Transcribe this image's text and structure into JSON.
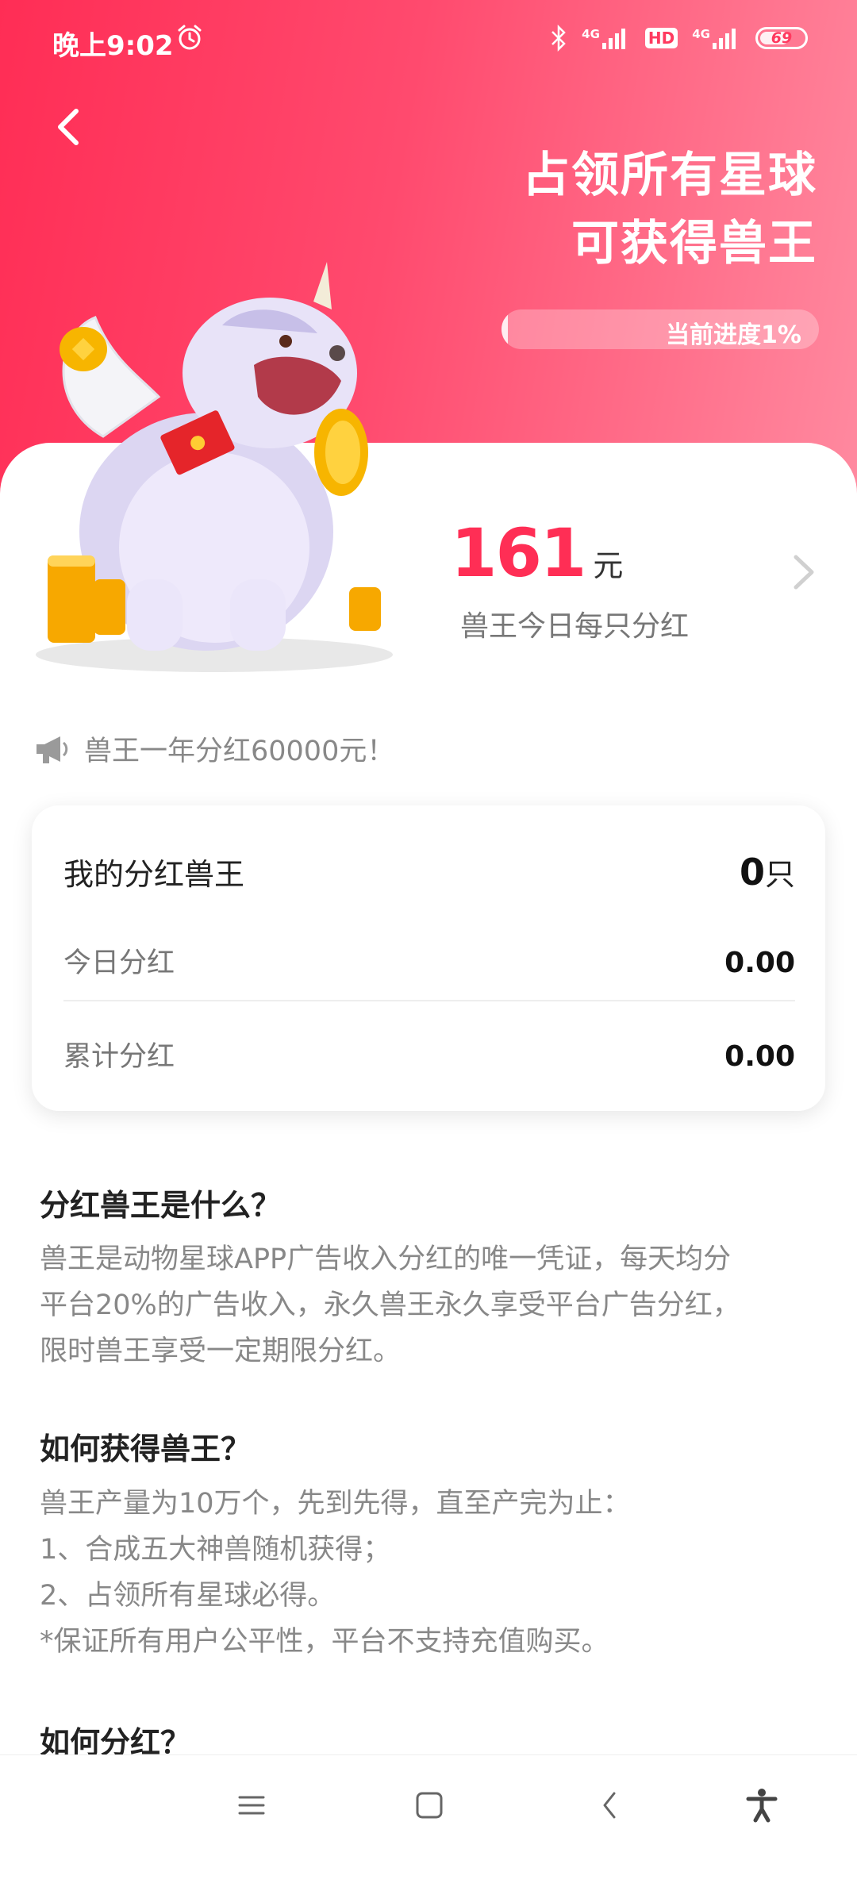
{
  "status_bar": {
    "time": "晚上9:02",
    "network_1": "4G",
    "hd_label": "HD",
    "network_2": "4G",
    "battery": "69"
  },
  "hero": {
    "title_line1": "占领所有星球",
    "title_line2": "可获得兽王",
    "progress_label": "当前进度1%",
    "progress_percent": 1
  },
  "dividend": {
    "amount": "161",
    "unit": "元",
    "caption": "兽王今日每只分红"
  },
  "notice": {
    "text": "兽王一年分红60000元！"
  },
  "stats": {
    "my_label": "我的分红兽王",
    "my_value": "0",
    "my_unit": "只",
    "today_label": "今日分红",
    "today_value": "0.00",
    "total_label": "累计分红",
    "total_value": "0.00"
  },
  "faq": [
    {
      "title": "分红兽王是什么？",
      "lines": [
        "兽王是动物星球APP广告收入分红的唯一凭证，每天均分",
        "平台20%的广告收入，永久兽王永久享受平台广告分红，",
        "限时兽王享受一定期限分红。"
      ]
    },
    {
      "title": "如何获得兽王？",
      "lines": [
        "兽王产量为10万个，先到先得，直至产完为止：",
        "1、合成五大神兽随机获得；",
        "2、占领所有星球必得。",
        "*保证所有用户公平性，平台不支持充值购买。"
      ]
    },
    {
      "title": "如何分红？",
      "lines": []
    }
  ],
  "colors": {
    "accent": "#ff2e55",
    "hero_gradient_start": "#ff2d55",
    "hero_gradient_end": "#ff8aa0"
  },
  "icons": [
    "back-arrow-icon",
    "alarm-clock-icon",
    "bluetooth-icon",
    "signal-icon",
    "battery-icon",
    "megaphone-icon",
    "chevron-right-icon",
    "menu-icon",
    "home-square-icon",
    "back-triangle-icon",
    "accessibility-icon"
  ]
}
